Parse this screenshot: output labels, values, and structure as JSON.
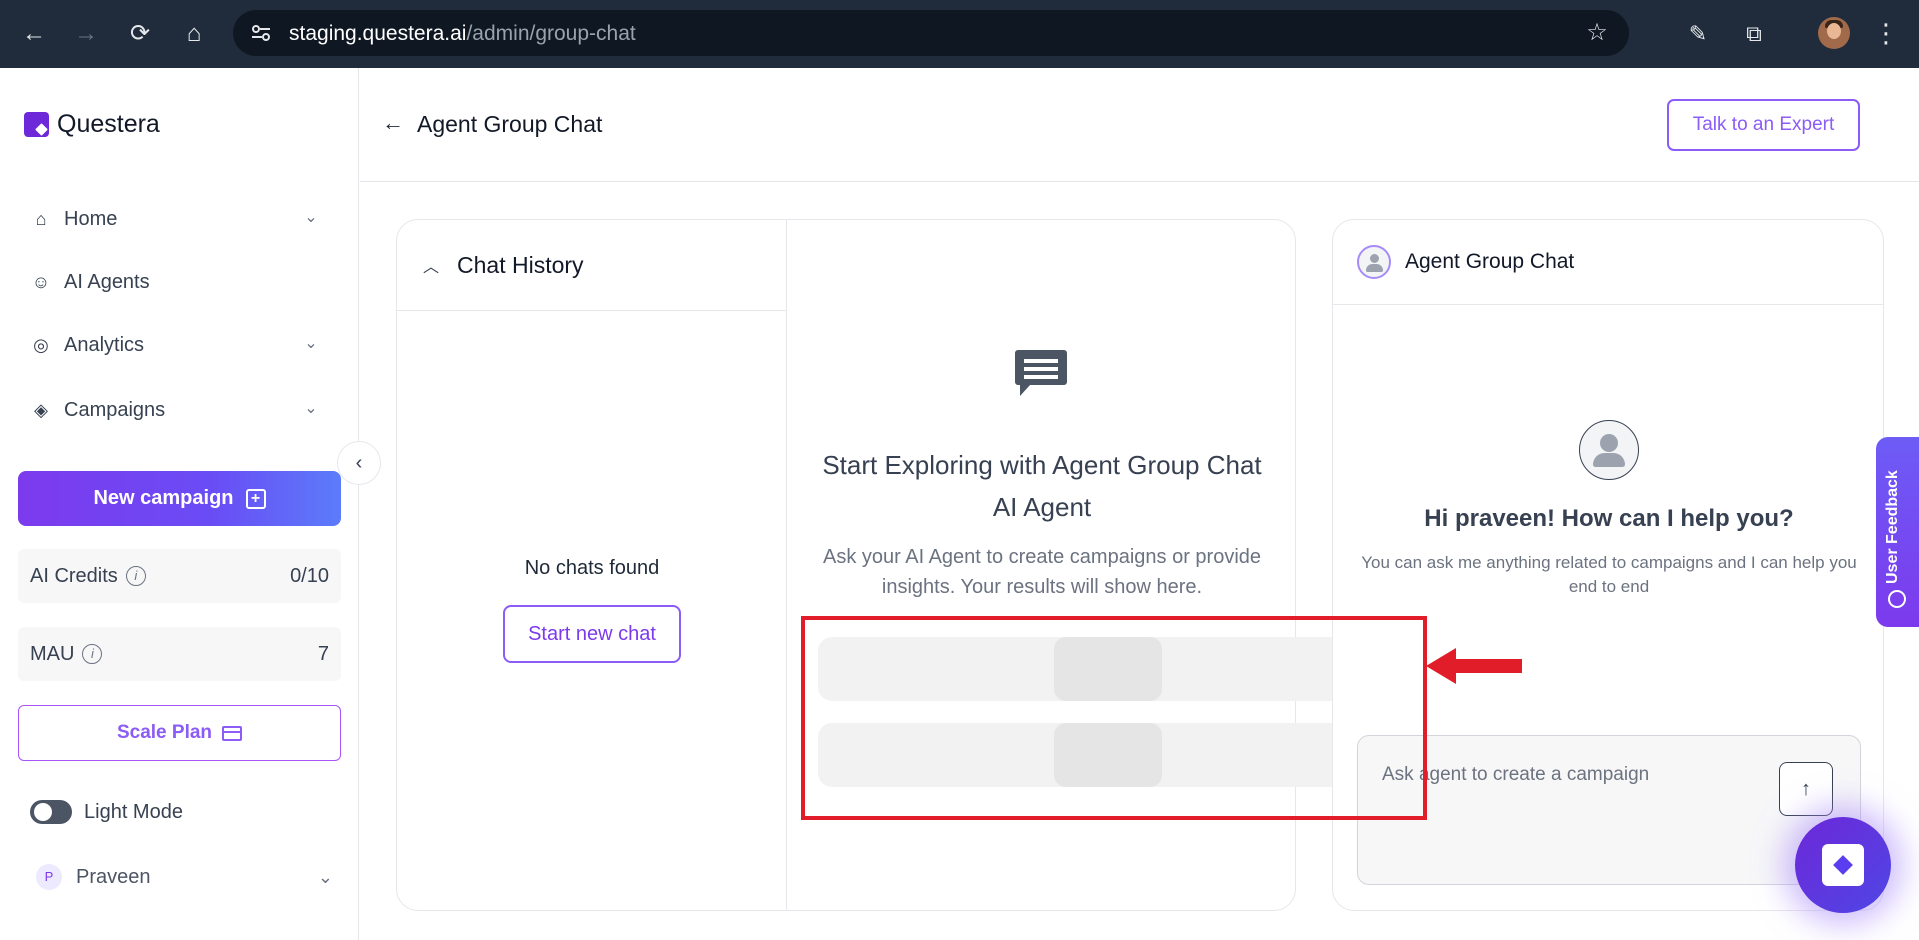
{
  "browser": {
    "url_host": "staging.questera.ai",
    "url_path": "/admin/group-chat"
  },
  "sidebar": {
    "brand": "Questera",
    "items": [
      {
        "label": "Home",
        "icon": "home-icon",
        "has_chevron": true
      },
      {
        "label": "AI Agents",
        "icon": "bot-icon",
        "has_chevron": false
      },
      {
        "label": "Analytics",
        "icon": "analytics-icon",
        "has_chevron": true
      },
      {
        "label": "Campaigns",
        "icon": "layers-icon",
        "has_chevron": true
      }
    ],
    "new_campaign_label": "New campaign",
    "ai_credits_label": "AI Credits",
    "ai_credits_value": "0/10",
    "mau_label": "MAU",
    "mau_value": "7",
    "scale_plan_label": "Scale Plan",
    "light_mode_label": "Light Mode",
    "user_initial": "P",
    "user_name": "Praveen"
  },
  "header": {
    "title": "Agent Group Chat",
    "expert_button": "Talk to an Expert"
  },
  "chat_history": {
    "title": "Chat History",
    "empty_text": "No chats found",
    "start_button": "Start new chat"
  },
  "results": {
    "title": "Start Exploring with Agent Group Chat AI Agent",
    "subtitle": "Ask your AI Agent to create campaigns or provide insights. Your results will show here."
  },
  "agent_panel": {
    "title": "Agent Group Chat",
    "greeting": "Hi praveen! How can I help you?",
    "greeting_sub": "You can ask me anything related to campaigns and I can help you end to end",
    "input_placeholder": "Ask agent to create a campaign"
  },
  "feedback": {
    "label": "User Feedback"
  },
  "colors": {
    "accent": "#8b5cf6",
    "annotation": "#e11d2a"
  }
}
